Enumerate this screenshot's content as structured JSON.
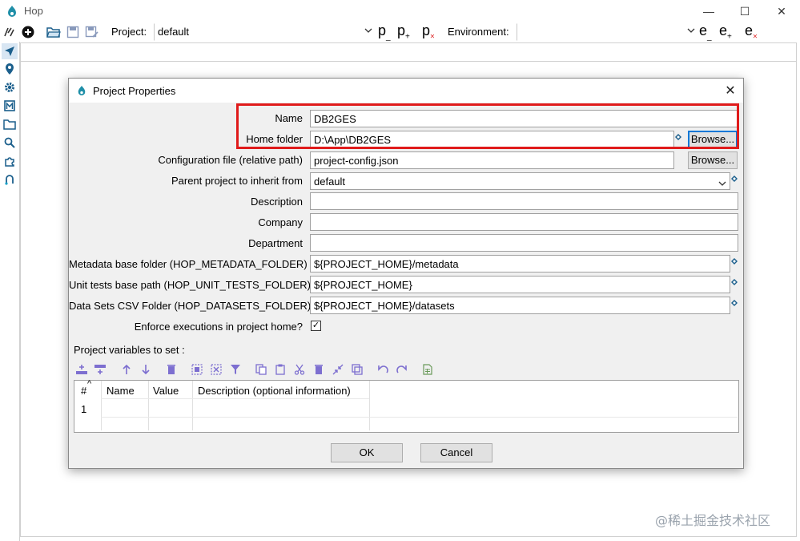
{
  "app": {
    "title": "Hop",
    "window_controls": {
      "minimize": "—",
      "maximize": "☐",
      "close": "✕"
    }
  },
  "toolbar": {
    "project_label": "Project:",
    "project_value": "default",
    "environment_label": "Environment:",
    "environment_value": "",
    "p_edit": "p",
    "p_add": "p",
    "p_delete": "p",
    "e_edit": "e",
    "e_add": "e",
    "e_delete": "e",
    "sub_edit": "_",
    "sub_add": "+",
    "sub_delete": "×"
  },
  "dialog": {
    "title": "Project Properties",
    "close": "✕",
    "fields": {
      "name": {
        "label": "Name",
        "value": "DB2GES"
      },
      "home_folder": {
        "label": "Home folder",
        "value": "D:\\App\\DB2GES"
      },
      "config_file": {
        "label": "Configuration file (relative path)",
        "value": "project-config.json"
      },
      "parent_project": {
        "label": "Parent project to inherit from",
        "value": "default"
      },
      "description": {
        "label": "Description",
        "value": ""
      },
      "company": {
        "label": "Company",
        "value": ""
      },
      "department": {
        "label": "Department",
        "value": ""
      },
      "metadata_folder": {
        "label": "Metadata base folder (HOP_METADATA_FOLDER)",
        "value": "${PROJECT_HOME}/metadata"
      },
      "unit_tests_path": {
        "label": "Unit tests base path (HOP_UNIT_TESTS_FOLDER)",
        "value": "${PROJECT_HOME}"
      },
      "datasets_folder": {
        "label": "Data Sets CSV Folder (HOP_DATASETS_FOLDER)",
        "value": "${PROJECT_HOME}/datasets"
      },
      "enforce_home": {
        "label": "Enforce executions in project home?",
        "checked": true,
        "mark": "✓"
      }
    },
    "browse_label": "Browse...",
    "variables_label": "Project variables to set :",
    "table": {
      "columns": [
        "#",
        "Name",
        "Value",
        "Description (optional information)"
      ],
      "sort_indicator": "^",
      "rows": [
        {
          "num": "1",
          "name": "",
          "value": "",
          "description": ""
        }
      ]
    },
    "ok_label": "OK",
    "cancel_label": "Cancel"
  },
  "watermark": "@稀土掘金技术社区",
  "colors": {
    "highlight_border": "#e01b1b",
    "toolbar_icon_purple": "#7d6fd0",
    "focus_blue": "#0078d7"
  }
}
